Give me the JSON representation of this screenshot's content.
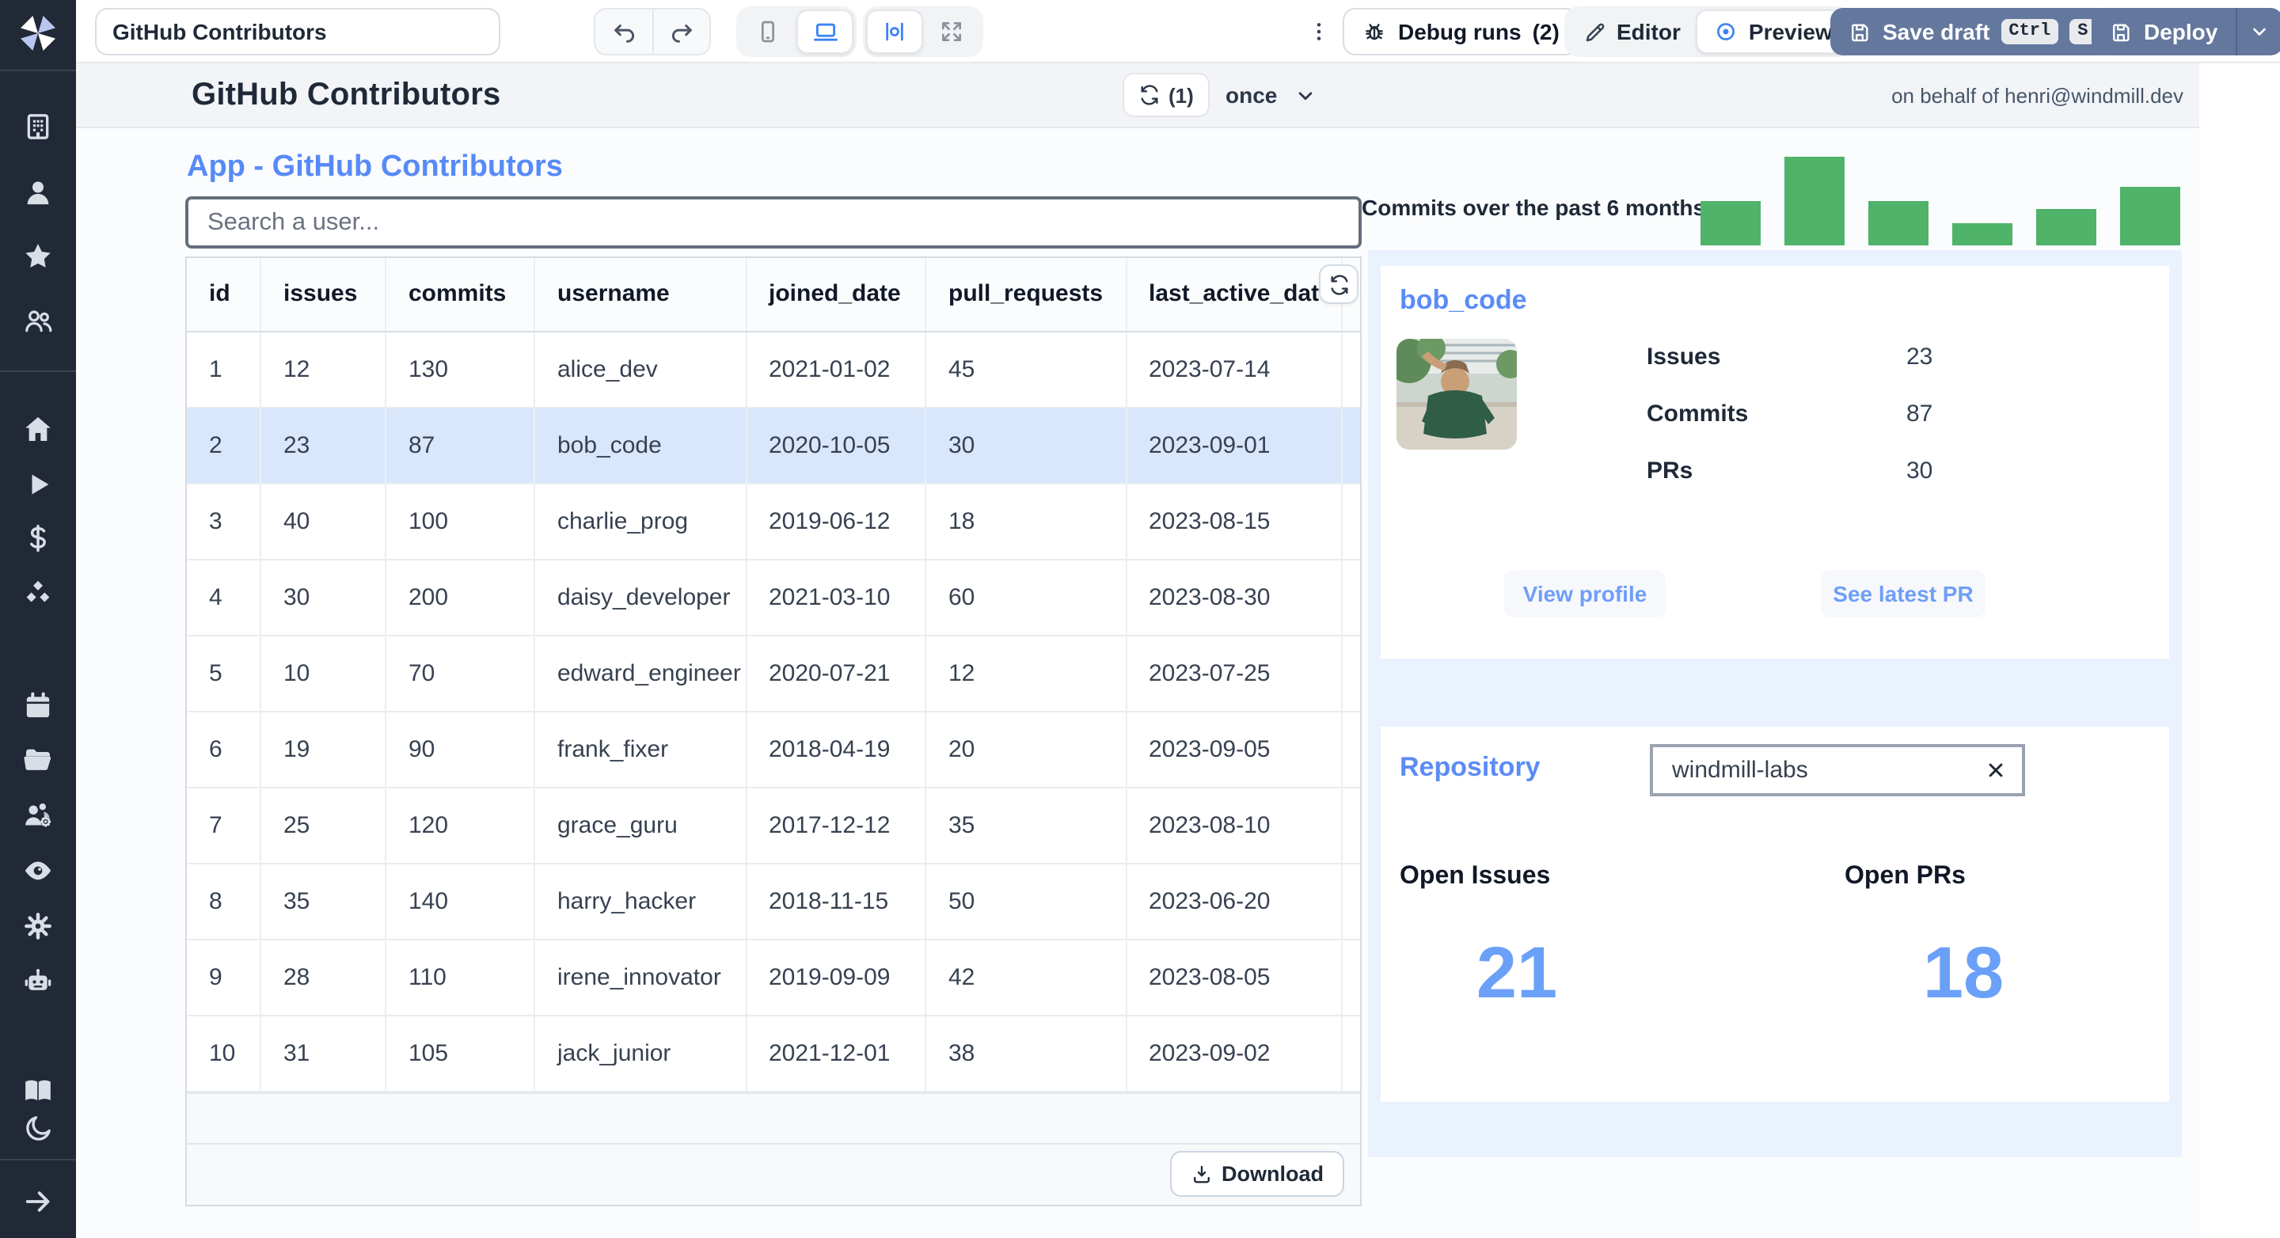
{
  "colors": {
    "accent_blue": "#578af8",
    "big_number_blue": "#6aa0f8",
    "bar_green": "#4fb36a",
    "dark_button": "#64789e",
    "selected_row": "#d9e7fc",
    "panel_blue": "#e9f2fe",
    "sidebar_bg": "#222936"
  },
  "sidebar": {
    "logo": "windmill-logo",
    "items": [
      "building-icon",
      "user-icon",
      "star-icon",
      "users-icon",
      "home-icon",
      "play-icon",
      "dollar-icon",
      "boxes-icon",
      "calendar-icon",
      "folder-icon",
      "users-cog-icon",
      "eye-icon",
      "settings-gear-icon",
      "robot-icon",
      "book-icon",
      "moon-icon",
      "arrow-right-icon"
    ]
  },
  "topbar": {
    "app_title_input": "GitHub Contributors",
    "debug_runs_label": "Debug runs",
    "debug_runs_count": "(2)",
    "editor_label": "Editor",
    "preview_label": "Preview",
    "save_draft_label": "Save draft",
    "kbd_ctrl": "Ctrl",
    "kbd_s": "S",
    "deploy_label": "Deploy"
  },
  "app_header": {
    "title": "GitHub Contributors",
    "refresh_count": "(1)",
    "schedule": "once",
    "on_behalf": "on behalf of henri@windmill.dev"
  },
  "main": {
    "page_title": "App - GitHub Contributors",
    "search_placeholder": "Search a user...",
    "table": {
      "columns": [
        "id",
        "issues",
        "commits",
        "username",
        "joined_date",
        "pull_requests",
        "last_active_date"
      ],
      "rows": [
        [
          "1",
          "12",
          "130",
          "alice_dev",
          "2021-01-02",
          "45",
          "2023-07-14"
        ],
        [
          "2",
          "23",
          "87",
          "bob_code",
          "2020-10-05",
          "30",
          "2023-09-01"
        ],
        [
          "3",
          "40",
          "100",
          "charlie_prog",
          "2019-06-12",
          "18",
          "2023-08-15"
        ],
        [
          "4",
          "30",
          "200",
          "daisy_developer",
          "2021-03-10",
          "60",
          "2023-08-30"
        ],
        [
          "5",
          "10",
          "70",
          "edward_engineer",
          "2020-07-21",
          "12",
          "2023-07-25"
        ],
        [
          "6",
          "19",
          "90",
          "frank_fixer",
          "2018-04-19",
          "20",
          "2023-09-05"
        ],
        [
          "7",
          "25",
          "120",
          "grace_guru",
          "2017-12-12",
          "35",
          "2023-08-10"
        ],
        [
          "8",
          "35",
          "140",
          "harry_hacker",
          "2018-11-15",
          "50",
          "2023-06-20"
        ],
        [
          "9",
          "28",
          "110",
          "irene_innovator",
          "2019-09-09",
          "42",
          "2023-08-05"
        ],
        [
          "10",
          "31",
          "105",
          "jack_junior",
          "2021-12-01",
          "38",
          "2023-09-02"
        ]
      ],
      "selected_row_index": 1,
      "download_label": "Download"
    }
  },
  "panel": {
    "user_card": {
      "title": "bob_code",
      "stats": [
        {
          "label": "Issues",
          "value": "23"
        },
        {
          "label": "Commits",
          "value": "87"
        },
        {
          "label": "PRs",
          "value": "30"
        }
      ],
      "buttons": {
        "view_profile": "View profile",
        "see_latest_pr": "See latest PR"
      }
    },
    "repo_card": {
      "title": "Repository",
      "input_value": "windmill-labs",
      "open_issues_label": "Open Issues",
      "open_issues": "21",
      "open_prs_label": "Open PRs",
      "open_prs": "18"
    }
  },
  "chart_data": {
    "type": "bar",
    "title": "Commits over the past 6 months:",
    "categories": [
      "",
      "",
      "",
      "",
      "",
      ""
    ],
    "values": [
      55,
      112,
      55,
      28,
      46,
      74
    ],
    "ylim": [
      0,
      112
    ],
    "bar_color": "#4fb36a",
    "axes_visible": false,
    "grid": false,
    "legend": "none",
    "note": "unlabeled sparkline-style monthly commit bars; values estimated from relative bar heights"
  }
}
